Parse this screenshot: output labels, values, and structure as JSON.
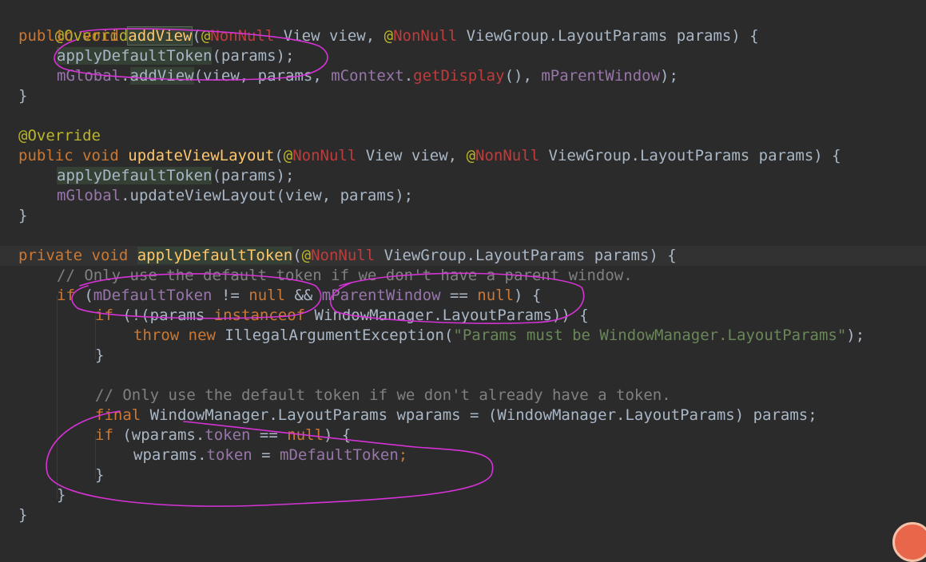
{
  "code": {
    "at_override_1": "@Override",
    "l1": {
      "public": "public ",
      "void": "void ",
      "name": "addView",
      "p1": "(",
      "ann1": "@",
      "nn1": "NonNull",
      "t1": " View view, ",
      "ann2": "@",
      "nn2": "NonNull",
      "t2": " ViewGroup.LayoutParams params) {"
    },
    "l2": {
      "call": "applyDefaultToken",
      "rest": "(params);"
    },
    "l3": {
      "field": "mGlobal",
      "dot": ".",
      "call": "addView",
      "args1": "(view, params, ",
      "field2": "mContext",
      "dot2": ".",
      "call2": "getDisplay",
      "args2": "(), ",
      "field3": "mParentWindow",
      "end": ");"
    },
    "close1": "}",
    "at_override_2": "@Override",
    "l6": {
      "public": "public ",
      "void": "void ",
      "name": "updateViewLayout",
      "p1": "(",
      "ann1": "@",
      "nn1": "NonNull",
      "t1": " View view, ",
      "ann2": "@",
      "nn2": "NonNull",
      "t2": " ViewGroup.LayoutParams params) {"
    },
    "l7": {
      "call": "applyDefaultToken",
      "rest": "(params);"
    },
    "l8": {
      "field": "mGlobal",
      "rest": ".updateViewLayout(view, params);"
    },
    "close2": "}",
    "l11": {
      "private": "private ",
      "void": "void ",
      "name": "applyDefaultToken",
      "p1": "(",
      "ann1": "@",
      "nn1": "NonNull",
      "t1": " ViewGroup.LayoutParams params) {"
    },
    "l12": "// Only use the default token if we don't have a parent window.",
    "l13": {
      "if": "if ",
      "p": "(",
      "f1": "mDefaultToken",
      "op1": " != ",
      "null1": "null",
      "and": " && ",
      "f2": "mParentWindow",
      "op2": " == ",
      "null2": "null",
      "end": ") {"
    },
    "l14": {
      "if": "if ",
      "p": "(!(params ",
      "instanceof": "instanceof",
      "rest": " WindowManager.LayoutParams)) {"
    },
    "l15": {
      "throw": "throw ",
      "new": "new ",
      "cls": "IllegalArgumentException(",
      "str": "\"Params must be WindowManager.LayoutParams\"",
      "end": ");"
    },
    "close3": "}",
    "l18": "// Only use the default token if we don't already have a token.",
    "l19": {
      "final": "final ",
      "rest": "WindowManager.LayoutParams wparams = (WindowManager.LayoutParams) params;"
    },
    "l20": {
      "if": "if ",
      "p": "(wparams.",
      "f": "token",
      "op": " == ",
      "null": "null",
      "end": ") {"
    },
    "l21": {
      "pre": "wparams.",
      "f": "token",
      "op": " = ",
      "f2": "mDefaultToken",
      "end": ";"
    },
    "close4": "}",
    "close5": "}",
    "close6": "}"
  },
  "colors": {
    "background": "#2b2b2b",
    "keyword": "#cc7832",
    "annotation": "#bbb529",
    "method": "#ffc66d",
    "comment": "#808080",
    "string": "#6a8759",
    "field": "#9876aa",
    "pen_marks": "#d633d6"
  }
}
